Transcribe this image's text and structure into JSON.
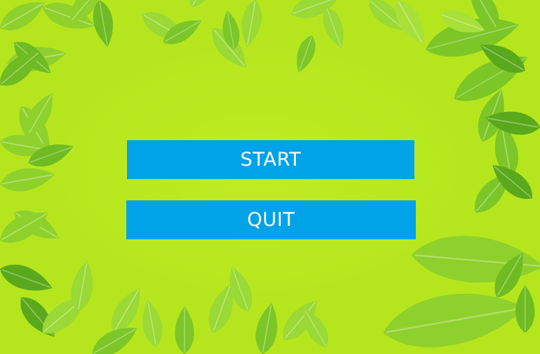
{
  "menu": {
    "start_label": "START",
    "quit_label": "QUIT"
  },
  "colors": {
    "background": "#b5e61d",
    "button": "#00a2e8",
    "button_text": "#ffffff",
    "leaf_light": "#a8e03a",
    "leaf_mid": "#7cc628",
    "leaf_dark": "#4e9a18"
  },
  "background": {
    "description_icon": "leaf-frame"
  }
}
